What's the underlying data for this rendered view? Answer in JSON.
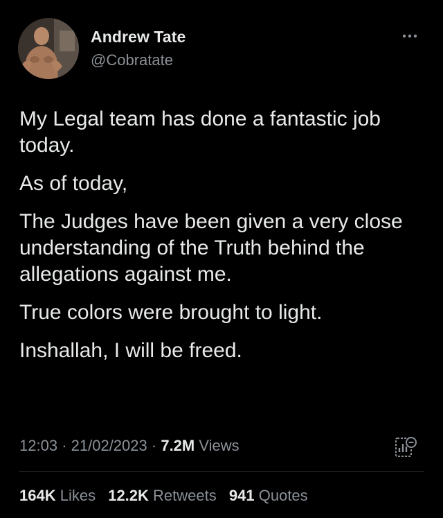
{
  "author": {
    "name": "Andrew Tate",
    "handle": "@Cobratate"
  },
  "tweet": {
    "paragraphs": [
      "My Legal team has done a fantastic job today.",
      "As of today,",
      "The Judges have been given a very close understanding of the Truth behind the allegations against me.",
      "True colors were brought to light.",
      "Inshallah, I will be freed."
    ],
    "time": "12:03",
    "date": "21/02/2023",
    "separator": "·",
    "views_count": "7.2M",
    "views_label": "Views"
  },
  "stats": {
    "likes_count": "164K",
    "likes_label": "Likes",
    "retweets_count": "12.2K",
    "retweets_label": "Retweets",
    "quotes_count": "941",
    "quotes_label": "Quotes"
  },
  "icons": {
    "more": "more-options-icon",
    "analytics": "analytics-icon"
  },
  "colors": {
    "background": "#000000",
    "primary_text": "#e7e9ea",
    "secondary_text": "#8b9197",
    "divider": "#2f3336"
  }
}
